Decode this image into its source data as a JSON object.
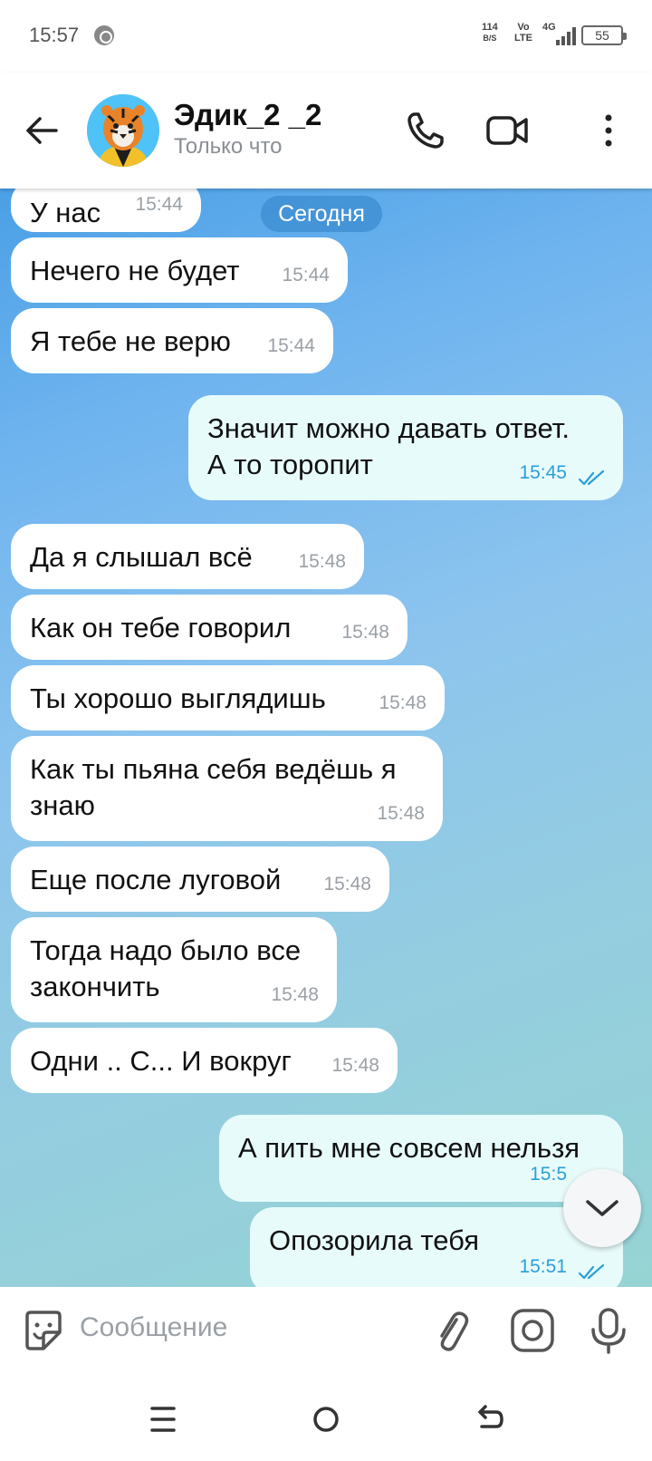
{
  "status_bar": {
    "time": "15:57",
    "net_speed_value": "114",
    "net_speed_unit": "B/S",
    "volte_top": "Vo",
    "volte_bottom": "LTE",
    "network": "4G",
    "battery": "55"
  },
  "header": {
    "contact_name": "Эдик_2 _2",
    "contact_status": "Только что"
  },
  "chat": {
    "date_label": "Сегодня",
    "messages": [
      {
        "direction": "in",
        "lines": [
          "У нас"
        ],
        "time": "15:44"
      },
      {
        "direction": "in",
        "lines": [
          "Нечего не будет"
        ],
        "time": "15:44"
      },
      {
        "direction": "in",
        "lines": [
          "Я тебе не верю"
        ],
        "time": "15:44"
      },
      {
        "direction": "out",
        "lines": [
          "Значит можно давать ответ.",
          "А то торопит"
        ],
        "time": "15:45",
        "read": true
      },
      {
        "direction": "in",
        "lines": [
          "Да я слышал всё"
        ],
        "time": "15:48"
      },
      {
        "direction": "in",
        "lines": [
          "Как он тебе говорил"
        ],
        "time": "15:48"
      },
      {
        "direction": "in",
        "lines": [
          "Ты хорошо выглядишь"
        ],
        "time": "15:48"
      },
      {
        "direction": "in",
        "lines": [
          "Как ты пьяна себя ведёшь я",
          "знаю"
        ],
        "time": "15:48"
      },
      {
        "direction": "in",
        "lines": [
          "Еще после луговой"
        ],
        "time": "15:48"
      },
      {
        "direction": "in",
        "lines": [
          "Тогда надо было все",
          "закончить"
        ],
        "time": "15:48"
      },
      {
        "direction": "in",
        "lines": [
          "Одни .. С... И вокруг"
        ],
        "time": "15:48"
      },
      {
        "direction": "out",
        "lines": [
          "А пить мне совсем нельзя"
        ],
        "time": "15:5",
        "read": true
      },
      {
        "direction": "out",
        "lines": [
          "Опозорила тебя"
        ],
        "time": "15:51",
        "read": true
      }
    ]
  },
  "input": {
    "placeholder": "Сообщение"
  },
  "icons": {
    "back": "arrow-left-icon",
    "call": "phone-icon",
    "video": "video-camera-icon",
    "menu": "more-vertical-icon",
    "sticker": "sticker-icon",
    "attach": "paperclip-icon",
    "camera": "camera-icon",
    "mic": "microphone-icon",
    "scroll_down": "chevron-down-icon"
  },
  "colors": {
    "incoming_bubble": "#ffffff",
    "outgoing_bubble": "#e8fbfb",
    "date_pill": "#3c8cd2",
    "read_check": "#2a9fd8"
  }
}
